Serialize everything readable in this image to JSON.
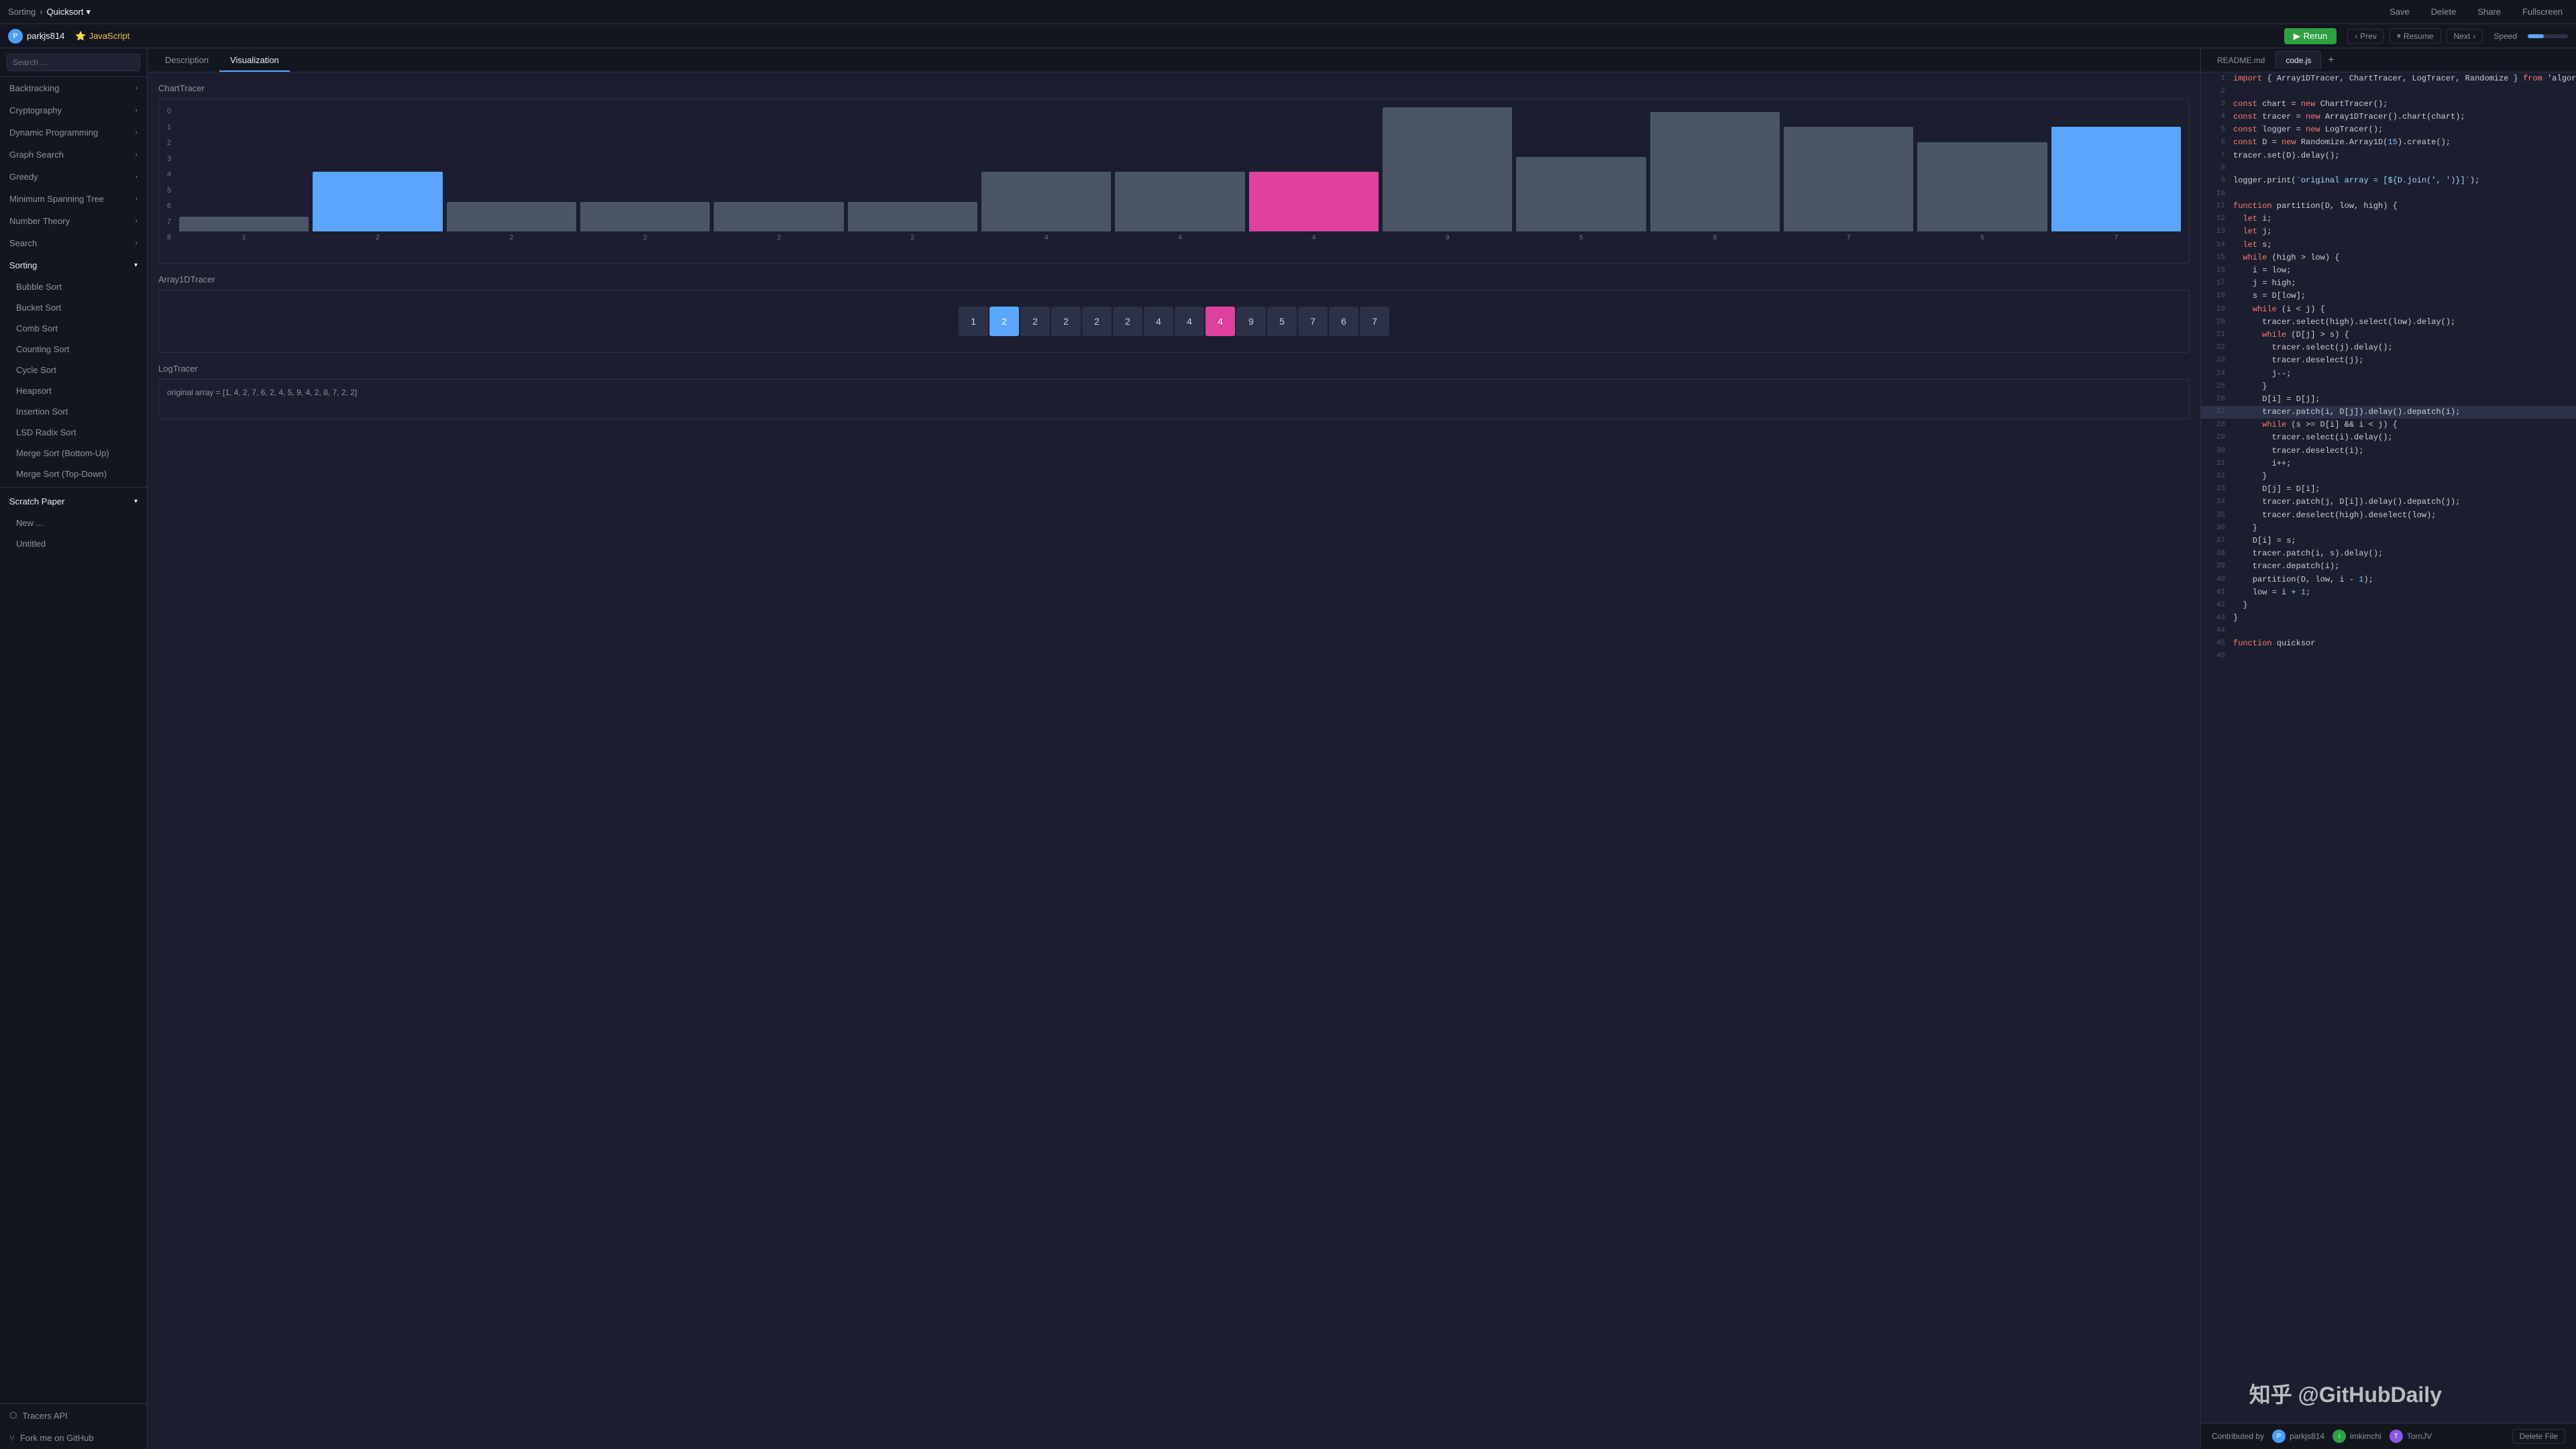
{
  "topbar": {
    "breadcrumb_sorting": "Sorting",
    "breadcrumb_sep": ">",
    "breadcrumb_algo": "Quicksort",
    "dropdown_icon": "▾",
    "save_label": "Save",
    "delete_label": "Delete",
    "share_label": "Share",
    "fullscreen_label": "Fullscreen"
  },
  "secondbar": {
    "user": "parkjs814",
    "lang": "JavaScript",
    "rerun_label": "Rerun",
    "prev_label": "Prev",
    "resume_label": "Resume",
    "next_label": "Next",
    "speed_label": "Speed"
  },
  "sidebar": {
    "search_placeholder": "Search ...",
    "items": [
      {
        "label": "Backtracking",
        "expandable": true
      },
      {
        "label": "Cryptography",
        "expandable": true
      },
      {
        "label": "Dynamic Programming",
        "expandable": true
      },
      {
        "label": "Graph Search",
        "expandable": true
      },
      {
        "label": "Greedy",
        "expandable": true
      },
      {
        "label": "Minimum Spanning Tree",
        "expandable": true
      },
      {
        "label": "Number Theory",
        "expandable": true
      },
      {
        "label": "Search",
        "expandable": true
      },
      {
        "label": "Sorting",
        "expandable": true,
        "expanded": true
      }
    ],
    "sorting_sub": [
      {
        "label": "Bubble Sort"
      },
      {
        "label": "Bucket Sort"
      },
      {
        "label": "Comb Sort"
      },
      {
        "label": "Counting Sort"
      },
      {
        "label": "Cycle Sort"
      },
      {
        "label": "Heapsort"
      },
      {
        "label": "Insertion Sort"
      },
      {
        "label": "LSD Radix Sort"
      },
      {
        "label": "Merge Sort (Bottom-Up)"
      },
      {
        "label": "Merge Sort (Top-Down)"
      }
    ],
    "scratch_paper": "Scratch Paper",
    "scratch_sub": [
      {
        "label": "New ..."
      },
      {
        "label": "Untitled"
      }
    ],
    "tracers_api": "Tracers API",
    "fork_github": "Fork me on GitHub"
  },
  "center": {
    "tab_description": "Description",
    "tab_visualization": "Visualization",
    "active_tab": "Visualization",
    "chart_tracer_title": "ChartTracer",
    "array_tracer_title": "Array1DTracer",
    "log_tracer_title": "LogTracer",
    "log_content": "original array = [1, 4, 2, 7, 6, 2, 4, 5, 9, 4, 2, 8, 7, 2, 2]",
    "chart_y_labels": [
      "0",
      "1",
      "2",
      "3",
      "4",
      "5",
      "6",
      "7",
      "8"
    ],
    "chart_bars": [
      {
        "value": 1,
        "label": "1",
        "type": "gray"
      },
      {
        "value": 4,
        "label": "2",
        "type": "blue"
      },
      {
        "value": 2,
        "label": "2",
        "type": "gray"
      },
      {
        "value": 2,
        "label": "2",
        "type": "gray"
      },
      {
        "value": 2,
        "label": "2",
        "type": "gray"
      },
      {
        "value": 2,
        "label": "2",
        "type": "gray"
      },
      {
        "value": 4,
        "label": "4",
        "type": "gray"
      },
      {
        "value": 4,
        "label": "4",
        "type": "gray"
      },
      {
        "value": 4,
        "label": "4",
        "type": "pink"
      },
      {
        "value": 9,
        "label": "9",
        "type": "gray"
      },
      {
        "value": 5,
        "label": "5",
        "type": "gray"
      },
      {
        "value": 8,
        "label": "8",
        "type": "gray"
      },
      {
        "value": 7,
        "label": "7",
        "type": "gray"
      },
      {
        "value": 6,
        "label": "6",
        "type": "gray"
      },
      {
        "value": 7,
        "label": "7",
        "type": "blue"
      }
    ],
    "array_cells": [
      {
        "value": "1",
        "type": "normal"
      },
      {
        "value": "2",
        "type": "blue"
      },
      {
        "value": "2",
        "type": "normal"
      },
      {
        "value": "2",
        "type": "normal"
      },
      {
        "value": "2",
        "type": "normal"
      },
      {
        "value": "2",
        "type": "normal"
      },
      {
        "value": "4",
        "type": "normal"
      },
      {
        "value": "4",
        "type": "normal"
      },
      {
        "value": "4",
        "type": "pink"
      },
      {
        "value": "9",
        "type": "normal"
      },
      {
        "value": "5",
        "type": "normal"
      },
      {
        "value": "7",
        "type": "normal"
      },
      {
        "value": "6",
        "type": "normal"
      },
      {
        "value": "7",
        "type": "normal"
      }
    ]
  },
  "code": {
    "tab_readme": "README.md",
    "tab_code": "code.js",
    "tab_add": "+",
    "highlighted_line": 27,
    "lines": [
      {
        "num": 1,
        "content": "import { Array1DTracer, ChartTracer, LogTracer, Randomize } from 'algorithm-vi"
      },
      {
        "num": 2,
        "content": ""
      },
      {
        "num": 3,
        "content": "const chart = new ChartTracer();"
      },
      {
        "num": 4,
        "content": "const tracer = new Array1DTracer().chart(chart);"
      },
      {
        "num": 5,
        "content": "const logger = new LogTracer();"
      },
      {
        "num": 6,
        "content": "const D = new Randomize.Array1D(15).create();"
      },
      {
        "num": 7,
        "content": "tracer.set(D).delay();"
      },
      {
        "num": 8,
        "content": ""
      },
      {
        "num": 9,
        "content": "logger.print(`original array = [${D.join(', ')}]`);"
      },
      {
        "num": 10,
        "content": ""
      },
      {
        "num": 11,
        "content": "function partition(D, low, high) {"
      },
      {
        "num": 12,
        "content": "  let i;"
      },
      {
        "num": 13,
        "content": "  let j;"
      },
      {
        "num": 14,
        "content": "  let s;"
      },
      {
        "num": 15,
        "content": "  while (high > low) {"
      },
      {
        "num": 16,
        "content": "    i = low;"
      },
      {
        "num": 17,
        "content": "    j = high;"
      },
      {
        "num": 18,
        "content": "    s = D[low];"
      },
      {
        "num": 19,
        "content": "    while (i < j) {"
      },
      {
        "num": 20,
        "content": "      tracer.select(high).select(low).delay();"
      },
      {
        "num": 21,
        "content": "      while (D[j] > s) {"
      },
      {
        "num": 22,
        "content": "        tracer.select(j).delay();"
      },
      {
        "num": 23,
        "content": "        tracer.deselect(j);"
      },
      {
        "num": 24,
        "content": "        j--;"
      },
      {
        "num": 25,
        "content": "      }"
      },
      {
        "num": 26,
        "content": "      D[i] = D[j];"
      },
      {
        "num": 27,
        "content": "      tracer.patch(i, D[j]).delay().depatch(i);"
      },
      {
        "num": 28,
        "content": "      while (s >= D[i] && i < j) {"
      },
      {
        "num": 29,
        "content": "        tracer.select(i).delay();"
      },
      {
        "num": 30,
        "content": "        tracer.deselect(i);"
      },
      {
        "num": 31,
        "content": "        i++;"
      },
      {
        "num": 32,
        "content": "      }"
      },
      {
        "num": 33,
        "content": "      D[j] = D[i];"
      },
      {
        "num": 34,
        "content": "      tracer.patch(j, D[i]).delay().depatch(j);"
      },
      {
        "num": 35,
        "content": "      tracer.deselect(high).deselect(low);"
      },
      {
        "num": 36,
        "content": "    }"
      },
      {
        "num": 37,
        "content": "    D[i] = s;"
      },
      {
        "num": 38,
        "content": "    tracer.patch(i, s).delay();"
      },
      {
        "num": 39,
        "content": "    tracer.depatch(i);"
      },
      {
        "num": 40,
        "content": "    partition(D, low, i - 1);"
      },
      {
        "num": 41,
        "content": "    low = i + 1;"
      },
      {
        "num": 42,
        "content": "  }"
      },
      {
        "num": 43,
        "content": "}"
      },
      {
        "num": 44,
        "content": ""
      },
      {
        "num": 45,
        "content": "function quicksor"
      },
      {
        "num": 46,
        "content": ""
      }
    ],
    "contributors_label": "Contributed by",
    "contributors": [
      {
        "name": "parkjs814",
        "color": "blue"
      },
      {
        "name": "imkimchi",
        "color": "green"
      },
      {
        "name": "TornJV",
        "color": "purple"
      }
    ],
    "delete_file_label": "Delete File"
  },
  "watermark": "知乎 @GitHubDaily"
}
